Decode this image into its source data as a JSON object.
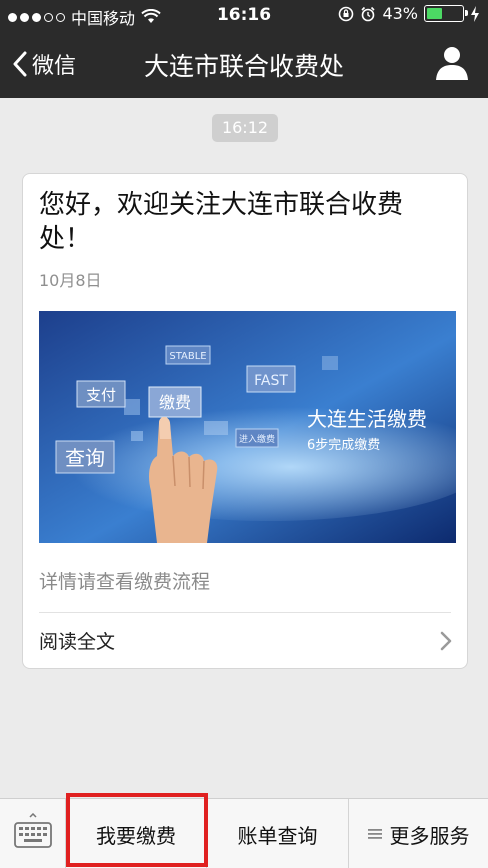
{
  "status_bar": {
    "carrier": "中国移动",
    "time": "16:16",
    "battery": "43%",
    "battery_level": 0.43
  },
  "nav": {
    "back_label": "微信",
    "title": "大连市联合收费处"
  },
  "chat": {
    "time_chip": "16:12"
  },
  "card": {
    "title": "您好，欢迎关注大连市联合收费处！",
    "date": "10月8日",
    "description": "详情请查看缴费流程",
    "read_more": "阅读全文",
    "image": {
      "heading": "大连生活缴费",
      "subheading": "6步完成缴费",
      "chips": [
        "STABLE",
        "FAST",
        "支付",
        "缴费",
        "查询",
        "进入缴费"
      ]
    }
  },
  "menu": {
    "btn1": "我要缴费",
    "btn2": "账单查询",
    "btn3": "更多服务"
  },
  "colors": {
    "nav_bg": "#2b2b2b",
    "highlight": "#e02020",
    "battery_fill": "#4cd964"
  }
}
